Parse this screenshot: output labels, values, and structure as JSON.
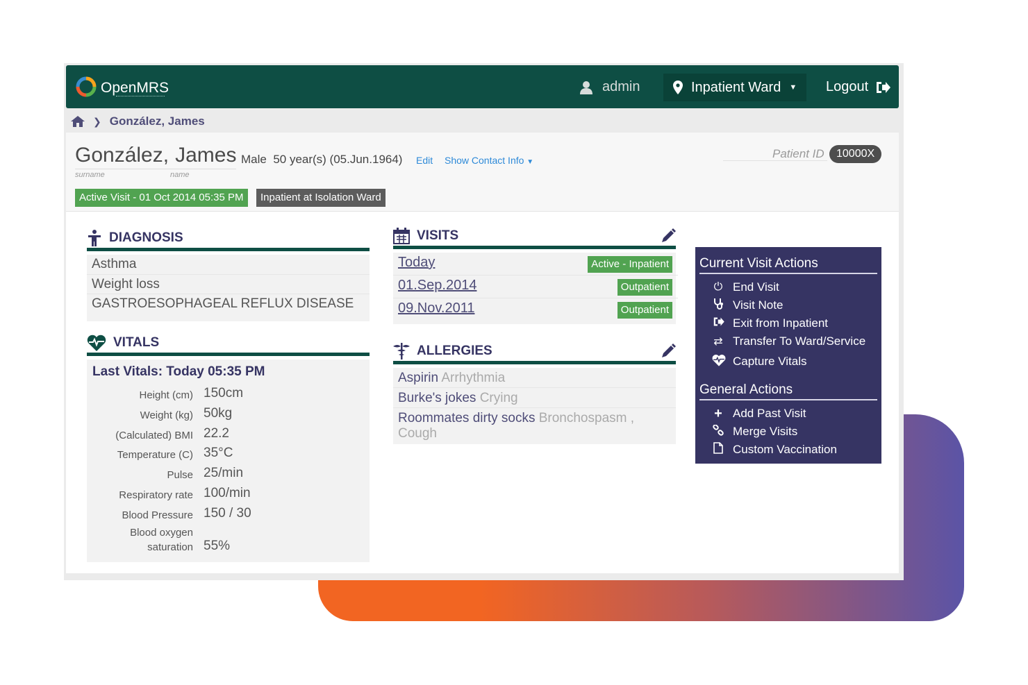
{
  "brand": {
    "name": "OpenMRS"
  },
  "nav": {
    "user": "admin",
    "location": "Inpatient Ward",
    "logout": "Logout"
  },
  "breadcrumb": {
    "home_icon": "home-icon",
    "patient": "González, James"
  },
  "patient": {
    "surname": "González,",
    "given": "James",
    "surname_label": "surname",
    "given_label": "name",
    "gender": "Male",
    "age": "50 year(s) (05.Jun.1964)",
    "edit_link": "Edit",
    "contact_link": "Show Contact Info",
    "id_label": "Patient ID",
    "id_value": "10000X",
    "visit_badge": "Active Visit - 01 Oct 2014 05:35 PM",
    "ward_badge": "Inpatient at Isolation Ward"
  },
  "diagnosis": {
    "title": "DIAGNOSIS",
    "items": [
      "Asthma",
      "Weight loss",
      "GASTROESOPHAGEAL REFLUX DISEASE"
    ]
  },
  "vitals": {
    "title": "VITALS",
    "last": "Last Vitals: Today 05:35 PM",
    "rows": [
      {
        "label": "Height (cm)",
        "value": "150cm"
      },
      {
        "label": "Weight (kg)",
        "value": "50kg"
      },
      {
        "label": "(Calculated) BMI",
        "value": "22.2"
      },
      {
        "label": "Temperature (C)",
        "value": "35°C"
      },
      {
        "label": "Pulse",
        "value": "25/min"
      },
      {
        "label": "Respiratory rate",
        "value": "100/min"
      },
      {
        "label": "Blood Pressure",
        "value": "150 / 30"
      },
      {
        "label": "Blood oxygen",
        "label2": "saturation",
        "value": "55%"
      }
    ]
  },
  "visits": {
    "title": "VISITS",
    "rows": [
      {
        "date": "Today",
        "type": "Active - Inpatient"
      },
      {
        "date": "01.Sep.2014",
        "type": "Outpatient"
      },
      {
        "date": "09.Nov.2011",
        "type": "Outpatient"
      }
    ]
  },
  "allergies": {
    "title": "ALLERGIES",
    "rows": [
      {
        "name": "Aspirin",
        "reaction": "Arrhythmia"
      },
      {
        "name": "Burke's jokes",
        "reaction": "Crying"
      },
      {
        "name": "Roommates dirty socks",
        "reaction": "Bronchospasm ,",
        "reaction2": "Cough"
      }
    ]
  },
  "actions": {
    "current_title": "Current Visit Actions",
    "current": [
      {
        "label": "End Visit",
        "icon": "power-icon"
      },
      {
        "label": "Visit Note",
        "icon": "stethoscope-icon"
      },
      {
        "label": "Exit from Inpatient",
        "icon": "sign-out-icon"
      },
      {
        "label": "Transfer To Ward/Service",
        "icon": "shuffle-icon"
      },
      {
        "label": "Capture Vitals",
        "icon": "heart-icon"
      }
    ],
    "general_title": "General Actions",
    "general": [
      {
        "label": "Add Past Visit",
        "icon": "plus-icon"
      },
      {
        "label": "Merge Visits",
        "icon": "link-icon"
      },
      {
        "label": "Custom Vaccination",
        "icon": "file-icon"
      }
    ]
  },
  "colors": {
    "topbar": "#0e4e44",
    "actions_bg": "#363463",
    "badge_green": "#51a351",
    "deco_orange": "#f26522",
    "deco_purple": "#5b54a6"
  }
}
